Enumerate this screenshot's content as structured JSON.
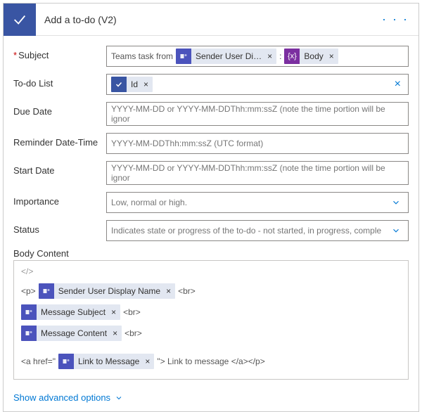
{
  "header": {
    "title": "Add a to-do (V2)",
    "icon": "checkmark-icon"
  },
  "fields": {
    "subject": {
      "label": "Subject",
      "prefixText": "Teams task from",
      "separator": ":",
      "tokens": [
        {
          "label": "Sender User Di…",
          "source": "teams"
        },
        {
          "label": "Body",
          "source": "var"
        }
      ]
    },
    "todoList": {
      "label": "To-do List",
      "token": {
        "label": "Id",
        "source": "outlook"
      }
    },
    "dueDate": {
      "label": "Due Date",
      "placeholder": "YYYY-MM-DD or YYYY-MM-DDThh:mm:ssZ (note the time portion will be ignor"
    },
    "reminder": {
      "label": "Reminder Date-Time",
      "placeholder": "YYYY-MM-DDThh:mm:ssZ (UTC format)"
    },
    "startDate": {
      "label": "Start Date",
      "placeholder": "YYYY-MM-DD or YYYY-MM-DDThh:mm:ssZ (note the time portion will be ignor"
    },
    "importance": {
      "label": "Importance",
      "placeholder": "Low, normal or high."
    },
    "status": {
      "label": "Status",
      "placeholder": "Indicates state or progress of the to-do - not started, in progress, comple"
    }
  },
  "bodyContent": {
    "label": "Body Content",
    "codeHint": "</>",
    "lines": [
      {
        "pre": "<p>",
        "token": {
          "label": "Sender User Display Name",
          "source": "teams"
        },
        "post": "<br>"
      },
      {
        "pre": "",
        "token": {
          "label": "Message Subject",
          "source": "teams"
        },
        "post": "<br>"
      },
      {
        "pre": "",
        "token": {
          "label": "Message Content",
          "source": "teams"
        },
        "post": "<br>"
      }
    ],
    "linkLine": {
      "pre": "<a href=\"",
      "token": {
        "label": "Link to Message",
        "source": "teams"
      },
      "mid": "\"> Link to message </a></p>"
    }
  },
  "footer": {
    "advanced": "Show advanced options"
  },
  "glyphs": {
    "x": "×",
    "fx": "{x}",
    "dots": "· · ·"
  }
}
